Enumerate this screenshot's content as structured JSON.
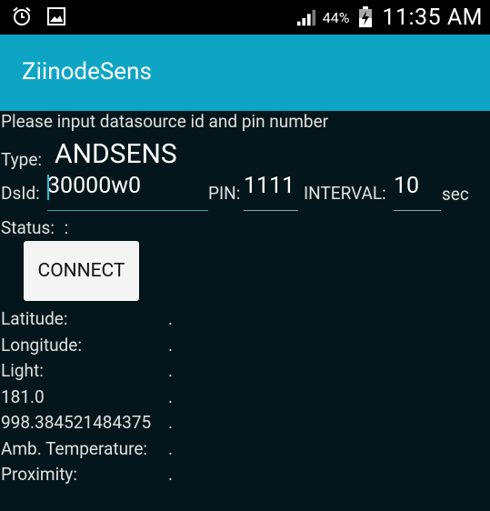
{
  "status_bar": {
    "icons_left": [
      "alarm-icon",
      "gallery-icon"
    ],
    "signal_icon": "signal-icon",
    "battery_percent": "44%",
    "time": "11:35 AM"
  },
  "app_bar": {
    "title": "ZiinodeSens",
    "color": "#0ea5c4"
  },
  "form": {
    "prompt": "Please input datasource id and pin number",
    "type_label": "Type:",
    "type_value": "ANDSENS",
    "dsid_label": "DsId:",
    "dsid_value": "30000w0",
    "pin_label": "PIN:",
    "pin_value": "1111",
    "interval_label": "INTERVAL:",
    "interval_value": "10",
    "interval_unit": "sec",
    "status_label": "Status:",
    "status_value": ":",
    "connect_label": "CONNECT"
  },
  "readings": [
    {
      "label": "Latitude:",
      "value": "."
    },
    {
      "label": "Longitude:",
      "value": "."
    },
    {
      "label": "Light:",
      "value": "."
    },
    {
      "label": "181.0",
      "value": "."
    },
    {
      "label": "998.384521484375",
      "value": "."
    },
    {
      "label": "Amb. Temperature:",
      "value": "."
    },
    {
      "label": "Proximity:",
      "value": "."
    }
  ]
}
